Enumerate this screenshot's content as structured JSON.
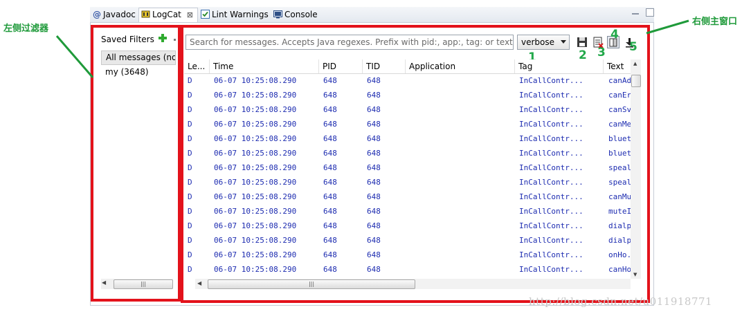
{
  "tabs": [
    {
      "label": "Javadoc",
      "icon": "at-icon",
      "active": false
    },
    {
      "label": "LogCat",
      "icon": "logcat-icon",
      "active": true,
      "close": "⊠"
    },
    {
      "label": "Lint Warnings",
      "icon": "checkbox-icon",
      "active": false
    },
    {
      "label": "Console",
      "icon": "console-icon",
      "active": false
    }
  ],
  "filters": {
    "title": "Saved Filters",
    "add_icon": "plus-icon",
    "items": [
      "All messages (no",
      "my (3648)"
    ]
  },
  "search": {
    "placeholder": "Search for messages. Accepts Java regexes. Prefix with pid:, app:, tag: or text: to"
  },
  "level": {
    "value": "verbose"
  },
  "toolbar_icons": [
    "save-icon",
    "clear-log-icon",
    "toggle-scroll-lock-icon",
    "scroll-to-end-icon"
  ],
  "columns": [
    "Le...",
    "Time",
    "PID",
    "TID",
    "Application",
    "Tag",
    "Text"
  ],
  "rows": [
    {
      "level": "D",
      "time": "06-07 10:25:08.290",
      "pid": "648",
      "tid": "648",
      "app": "",
      "tag": "InCallContr...",
      "text": "canAd"
    },
    {
      "level": "D",
      "time": "06-07 10:25:08.290",
      "pid": "648",
      "tid": "648",
      "app": "",
      "tag": "InCallContr...",
      "text": "canEr"
    },
    {
      "level": "D",
      "time": "06-07 10:25:08.290",
      "pid": "648",
      "tid": "648",
      "app": "",
      "tag": "InCallContr...",
      "text": "canSv"
    },
    {
      "level": "D",
      "time": "06-07 10:25:08.290",
      "pid": "648",
      "tid": "648",
      "app": "",
      "tag": "InCallContr...",
      "text": "canMe"
    },
    {
      "level": "D",
      "time": "06-07 10:25:08.290",
      "pid": "648",
      "tid": "648",
      "app": "",
      "tag": "InCallContr...",
      "text": "bluet"
    },
    {
      "level": "D",
      "time": "06-07 10:25:08.290",
      "pid": "648",
      "tid": "648",
      "app": "",
      "tag": "InCallContr...",
      "text": "bluet"
    },
    {
      "level": "D",
      "time": "06-07 10:25:08.290",
      "pid": "648",
      "tid": "648",
      "app": "",
      "tag": "InCallContr...",
      "text": "speal"
    },
    {
      "level": "D",
      "time": "06-07 10:25:08.290",
      "pid": "648",
      "tid": "648",
      "app": "",
      "tag": "InCallContr...",
      "text": "speal"
    },
    {
      "level": "D",
      "time": "06-07 10:25:08.290",
      "pid": "648",
      "tid": "648",
      "app": "",
      "tag": "InCallContr...",
      "text": "canMu"
    },
    {
      "level": "D",
      "time": "06-07 10:25:08.290",
      "pid": "648",
      "tid": "648",
      "app": "",
      "tag": "InCallContr...",
      "text": "muteI"
    },
    {
      "level": "D",
      "time": "06-07 10:25:08.290",
      "pid": "648",
      "tid": "648",
      "app": "",
      "tag": "InCallContr...",
      "text": "dialp"
    },
    {
      "level": "D",
      "time": "06-07 10:25:08.290",
      "pid": "648",
      "tid": "648",
      "app": "",
      "tag": "InCallContr...",
      "text": "dialp"
    },
    {
      "level": "D",
      "time": "06-07 10:25:08.290",
      "pid": "648",
      "tid": "648",
      "app": "",
      "tag": "InCallContr...",
      "text": "onHo."
    },
    {
      "level": "D",
      "time": "06-07 10:25:08.290",
      "pid": "648",
      "tid": "648",
      "app": "",
      "tag": "InCallContr...",
      "text": "canHo"
    }
  ],
  "annotations": {
    "left_label": "左侧过滤器",
    "right_label": "右侧主窗口",
    "numbers": [
      "1",
      "2",
      "3",
      "4",
      "5"
    ],
    "color": "#22a84a",
    "box_color": "#e3121b"
  },
  "watermark": "http://blog.csdn.net/u011918771",
  "scroll_glyphs": {
    "up": "▲",
    "down": "▼",
    "left": "◀",
    "right": "▶",
    "grip": "|||"
  }
}
